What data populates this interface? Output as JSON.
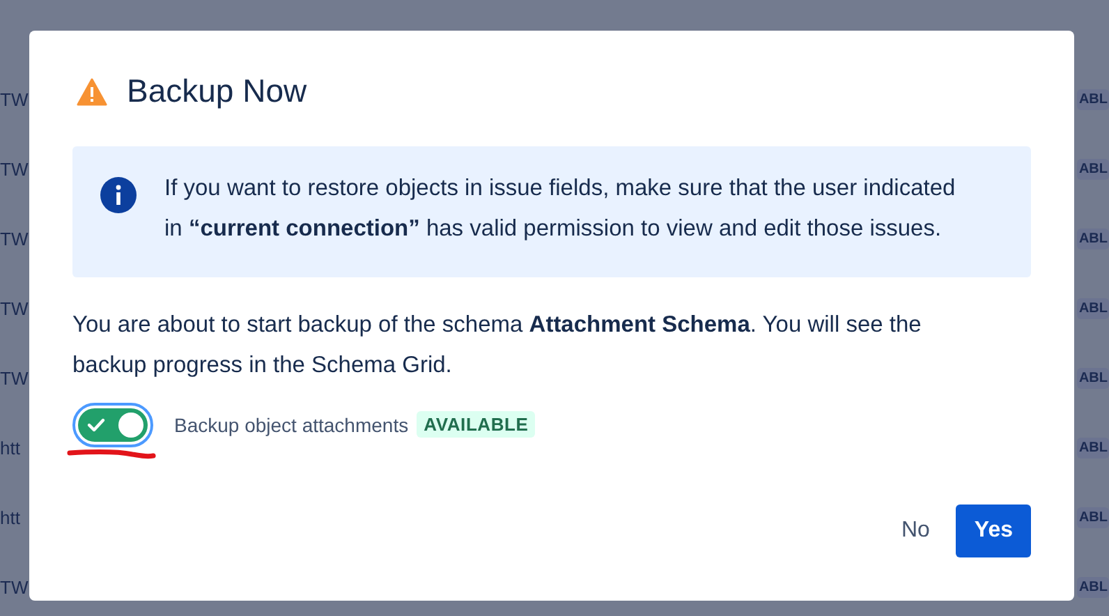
{
  "background": {
    "rows": [
      {
        "name": "TW",
        "status": "ABL"
      },
      {
        "name": "TW",
        "status": "ABL"
      },
      {
        "name": "TW",
        "status": "ABL"
      },
      {
        "name": "TW",
        "status": "ABL"
      },
      {
        "name": "TW",
        "status": "ABL"
      },
      {
        "name": "htt",
        "status": "ABL"
      },
      {
        "name": "htt",
        "status": "ABL"
      },
      {
        "name": "TW",
        "status": "ABL"
      }
    ]
  },
  "dialog": {
    "title": "Backup Now",
    "info": "If you want to restore objects in issue fields, make sure that the user indicated in **“current connection”** has valid permission to view and edit those issues.",
    "body": "You are about to start backup of the schema **Attachment Schema**. You will see the backup progress in the Schema Grid.",
    "toggle": {
      "label": "Backup object attachments",
      "on": true,
      "badge": "AVAILABLE"
    },
    "buttons": [
      {
        "label": "No",
        "kind": "subtle"
      },
      {
        "label": "Yes",
        "kind": "primary"
      }
    ]
  }
}
